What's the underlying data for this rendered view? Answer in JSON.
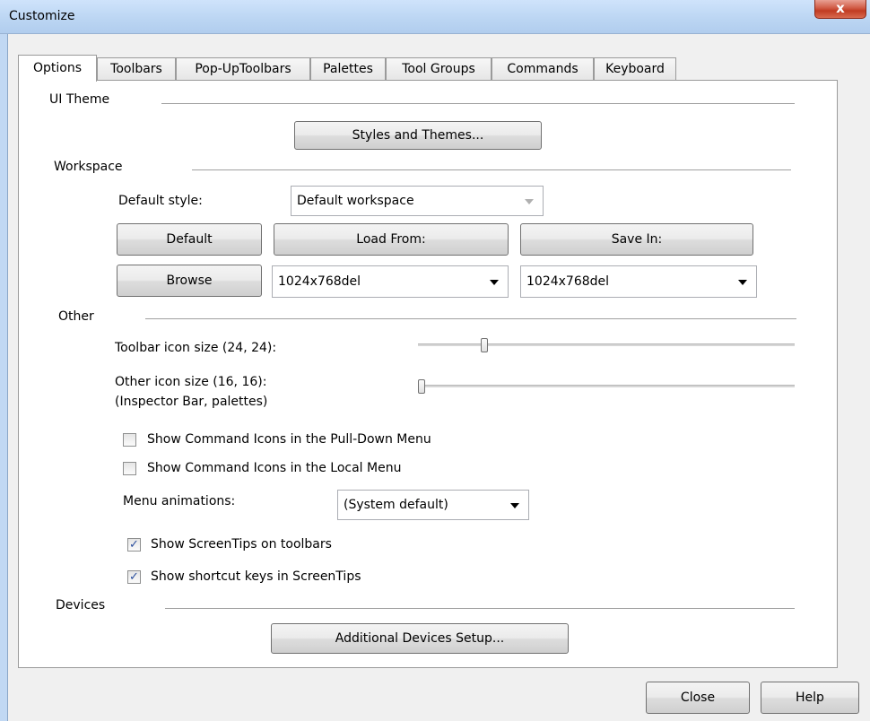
{
  "window": {
    "title": "Customize",
    "close_glyph": "x"
  },
  "tabs": [
    {
      "label": "Options",
      "active": true
    },
    {
      "label": "Toolbars",
      "active": false
    },
    {
      "label": "Pop-UpToolbars",
      "active": false
    },
    {
      "label": "Palettes",
      "active": false
    },
    {
      "label": "Tool Groups",
      "active": false
    },
    {
      "label": "Commands",
      "active": false
    },
    {
      "label": "Keyboard",
      "active": false
    }
  ],
  "ui_theme": {
    "label": "UI Theme",
    "button": "Styles and Themes..."
  },
  "workspace": {
    "label": "Workspace",
    "default_style_label": "Default style:",
    "default_style_value": "Default workspace",
    "default_button": "Default",
    "load_button": "Load From:",
    "save_button": "Save In:",
    "browse_button": "Browse",
    "load_value": "1024x768del",
    "save_value": "1024x768del"
  },
  "other": {
    "label": "Other",
    "toolbar_icon_label": "Toolbar icon size (24, 24):",
    "toolbar_icon_level": 0.17,
    "other_icon_label_1": "Other icon size (16, 16):",
    "other_icon_label_2": "(Inspector Bar, palettes)",
    "other_icon_level": 0.0,
    "cb_pulldown": {
      "label": "Show Command Icons in the Pull-Down Menu",
      "checked": false
    },
    "cb_local": {
      "label": "Show Command Icons in the Local Menu",
      "checked": false
    },
    "menu_anim_label": "Menu animations:",
    "menu_anim_value": "(System default)",
    "cb_screentips": {
      "label": "Show ScreenTips on toolbars",
      "checked": true
    },
    "cb_shortcut": {
      "label": "Show shortcut keys in ScreenTips",
      "checked": true
    }
  },
  "devices": {
    "label": "Devices",
    "button": "Additional Devices Setup..."
  },
  "footer": {
    "close": "Close",
    "help": "Help"
  },
  "check_glyph": "✓"
}
